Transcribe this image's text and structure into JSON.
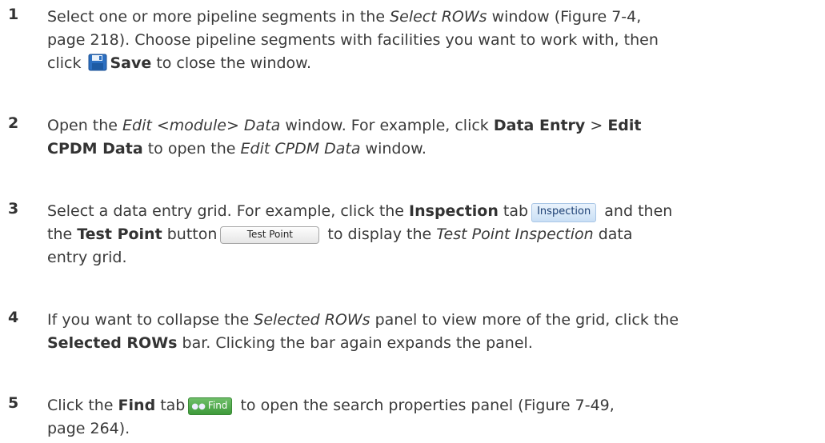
{
  "steps": [
    {
      "number": "1",
      "t1": "Select one or more pipeline segments in the ",
      "t2": "Select ROWs",
      "t3": " window (Figure 7-4,",
      "line2": "page 218). Choose pipeline segments with facilities you want to work with, then",
      "t4": "click ",
      "save_icon": "save-disk-icon",
      "t5": "Save",
      "t6": " to close the window."
    },
    {
      "number": "2",
      "t1": "Open the ",
      "t2": "Edit <module> Data",
      "t3": " window. For example, click ",
      "t4": "Data Entry",
      "t5": " > ",
      "t6": "Edit",
      "t7": "CPDM Data",
      "t8": " to open the ",
      "t9": "Edit CPDM Data",
      "t10": " window."
    },
    {
      "number": "3",
      "t1": "Select a data entry grid. For example, click the ",
      "t2": "Inspection",
      "t3": " tab",
      "tab_label": "Inspection",
      "t4": " and then",
      "t5": "the ",
      "t6": "Test Point",
      "t7": " button",
      "button_label": "Test Point",
      "t8": " to display the ",
      "t9": "Test Point Inspection",
      "t10": " data",
      "line3": "entry grid."
    },
    {
      "number": "4",
      "t1": "If you want to collapse the ",
      "t2": "Selected ROWs",
      "t3": " panel to view more of the grid, click the",
      "t4": "Selected ROWs",
      "t5": " bar. Clicking the bar again expands the panel."
    },
    {
      "number": "5",
      "t1": "Click the ",
      "t2": "Find",
      "t3": " tab",
      "find_label": "Find",
      "find_icon": "binoculars-icon",
      "t4": " to open the search properties panel (Figure 7-49,",
      "line2": "page 264)."
    }
  ]
}
